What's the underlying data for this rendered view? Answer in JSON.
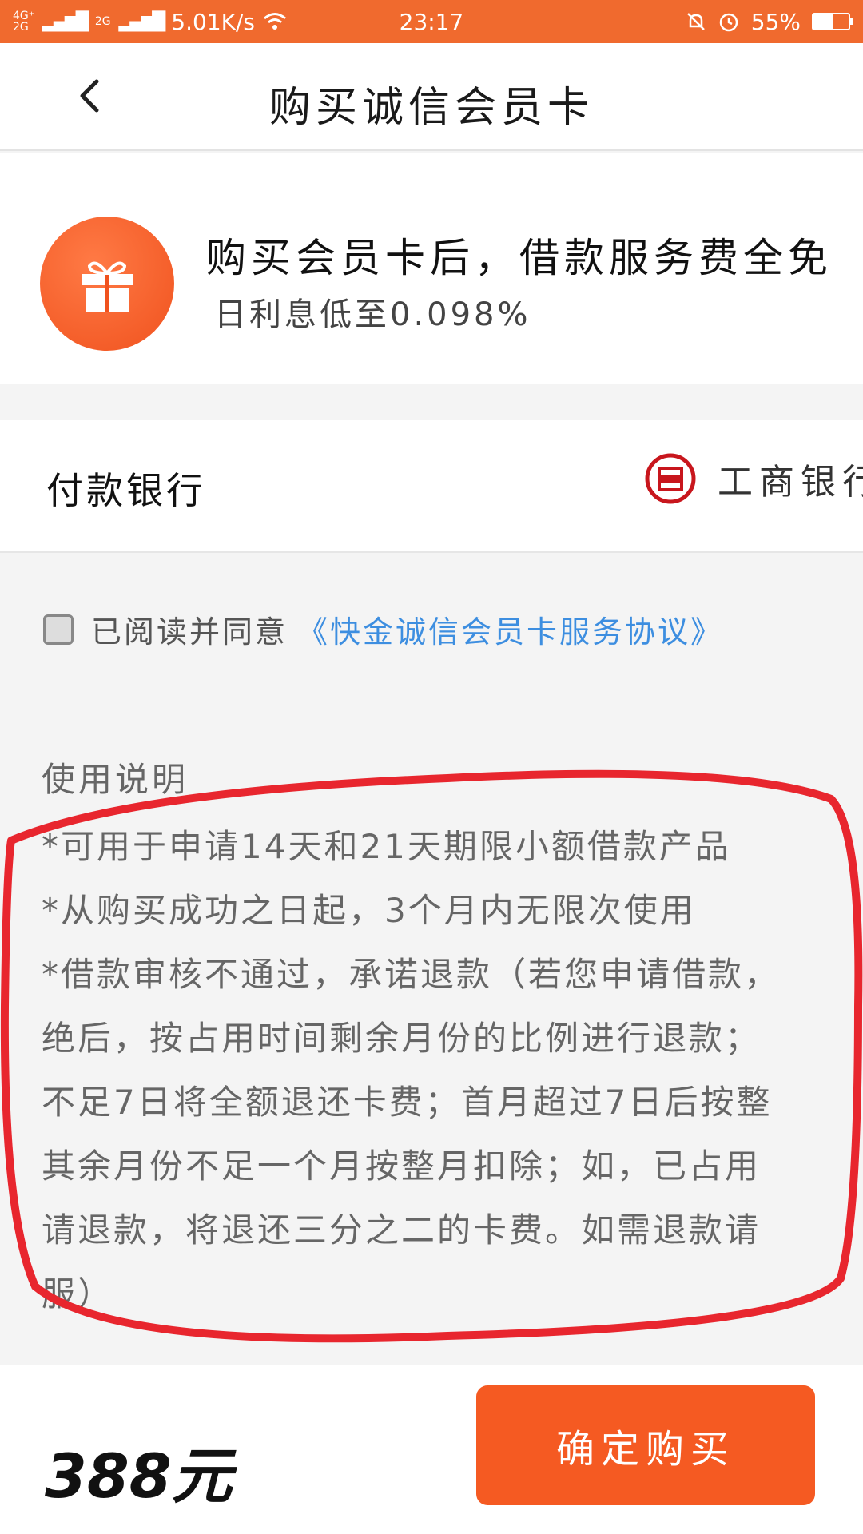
{
  "status_bar": {
    "network_top": "4G⁺",
    "network_bottom": "2G",
    "network2": "2G",
    "speed": "5.01K/s",
    "time": "23:17",
    "battery": "55%",
    "battery_level": 0.55
  },
  "nav": {
    "title": "购买诚信会员卡",
    "back_icon": "back-arrow-icon"
  },
  "promo": {
    "icon": "gift-icon",
    "headline": "购买会员卡后，借款服务费全免",
    "subline": "日利息低至0.098%"
  },
  "bank": {
    "label": "付款银行",
    "logo": "icbc-logo-icon",
    "name": "工商银行"
  },
  "agreement": {
    "checked": false,
    "text": "已阅读并同意",
    "link": "《快金诚信会员卡服务协议》"
  },
  "usage": {
    "title": "使用说明",
    "lines": [
      "*可用于申请14天和21天期限小额借款产品",
      "*从购买成功之日起，3个月内无限次使用",
      "*借款审核不通过，承诺退款（若您申请借款，",
      "绝后，按占用时间剩余月份的比例进行退款；",
      "不足7日将全额退还卡费；首月超过7日后按整",
      "其余月份不足一个月按整月扣除；如，已占用",
      "请退款，将退还三分之二的卡费。如需退款请",
      "服）"
    ]
  },
  "footer": {
    "price": "388元",
    "buy_label": "确定购买"
  },
  "colors": {
    "accent": "#f06a2e",
    "link": "#3d8ee0",
    "annotation": "#e8262e"
  }
}
